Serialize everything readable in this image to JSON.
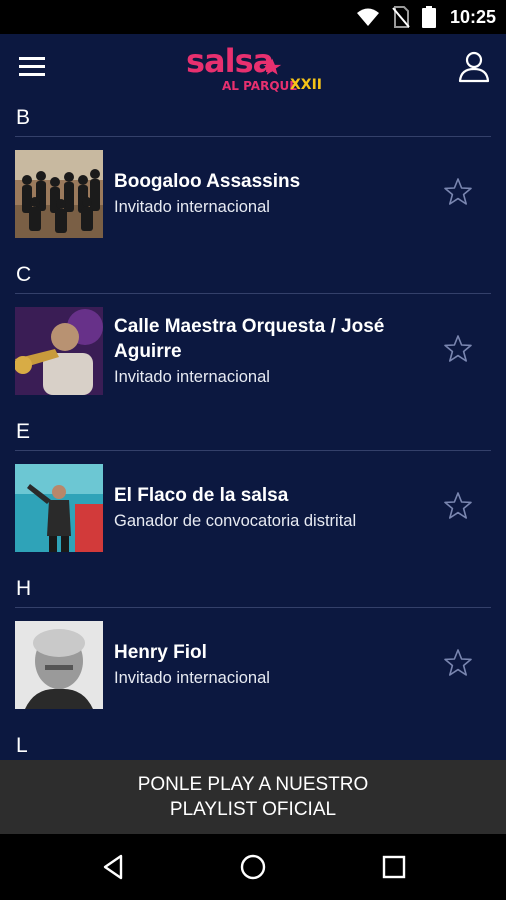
{
  "status_bar": {
    "time": "10:25",
    "icons": [
      "wifi-icon",
      "no-sim-icon",
      "battery-icon"
    ]
  },
  "header": {
    "logo_main": "salsa",
    "logo_sub": "AL PARQUE",
    "logo_edition": "XXII",
    "menu_icon": "hamburger-menu-icon",
    "account_icon": "user-account-icon"
  },
  "sections": [
    {
      "letter": "B",
      "artists": [
        {
          "name": "Boogaloo Assassins",
          "category": "Invitado internacional",
          "favorite": false
        }
      ]
    },
    {
      "letter": "C",
      "artists": [
        {
          "name": "Calle Maestra Orquesta / José Aguirre",
          "category": "Invitado internacional",
          "favorite": false
        }
      ]
    },
    {
      "letter": "E",
      "artists": [
        {
          "name": "El Flaco de la salsa",
          "category": "Ganador de convocatoria distrital",
          "favorite": false
        }
      ]
    },
    {
      "letter": "H",
      "artists": [
        {
          "name": "Henry Fiol",
          "category": "Invitado internacional",
          "favorite": false
        }
      ]
    },
    {
      "letter": "L",
      "artists": []
    }
  ],
  "banner": {
    "label": "PONLE PLAY A NUESTRO PLAYLIST OFICIAL"
  },
  "nav_bar": {
    "icons": [
      "back-icon",
      "home-icon",
      "recents-icon"
    ]
  },
  "colors": {
    "background": "#0c1840",
    "logo_pink": "#e8306f",
    "logo_yellow": "#f6c417",
    "banner": "#2d2d2d",
    "star_outline": "#7a86b0"
  }
}
